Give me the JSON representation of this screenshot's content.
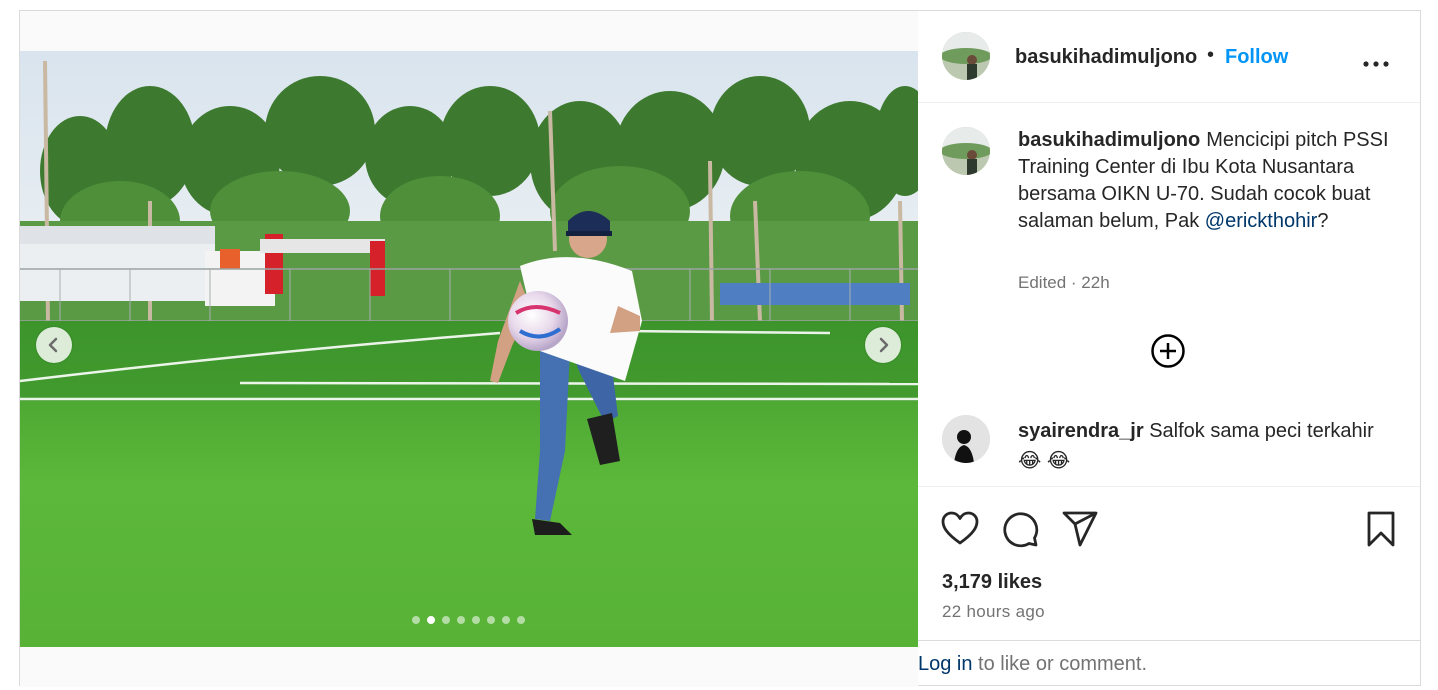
{
  "post": {
    "author": "basukihadimuljono",
    "follow_label": "Follow",
    "bullet": "•",
    "caption_text": "Mencicipi pitch PSSI Training Center di Ibu Kota Nusantara bersama OIKN U-70. Sudah cocok buat salaman belum, Pak",
    "caption_mention": "@erickthohir",
    "caption_end": "?",
    "meta": "Edited · 22h",
    "likes": "3,179 likes",
    "time": "22 hours ago"
  },
  "carousel": {
    "total_slides": 8,
    "active_slide": 2
  },
  "comment": {
    "user": "syairendra_jr",
    "text": "Salfok sama peci terkahir",
    "emoji": "😂 😂"
  },
  "login": {
    "link": "Log in",
    "rest": " to like or comment."
  },
  "icons": [
    "chevron-left-icon",
    "chevron-right-icon",
    "more-icon",
    "add-circle-icon",
    "heart-icon",
    "comment-icon",
    "share-icon",
    "bookmark-icon"
  ],
  "colors": {
    "accent": "#0095f6",
    "mention": "#00376b",
    "muted": "#737373"
  }
}
